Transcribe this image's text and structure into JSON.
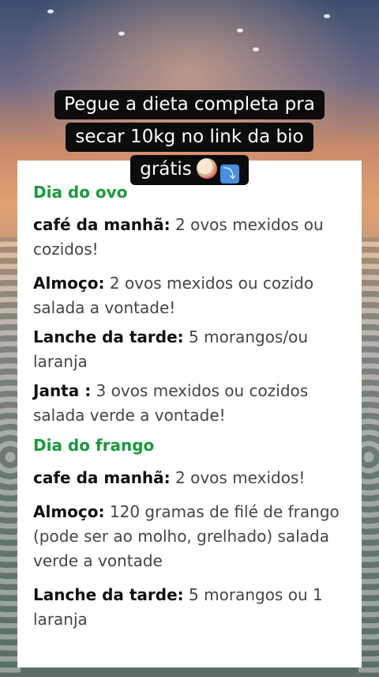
{
  "caption": {
    "line1": "Pegue a dieta completa pra",
    "line2": "secar 10kg no link da bio",
    "line3": "grátis"
  },
  "sections": [
    {
      "title": "Dia do ovo",
      "meals": [
        {
          "label": "café da manhã:",
          "text": " 2 ovos mexidos ou cozidos!"
        },
        {
          "label": "Almoço:",
          "text": " 2 ovos mexidos ou cozido salada a vontade!"
        },
        {
          "label": "Lanche da tarde:",
          "text": " 5 morangos/ou laranja"
        },
        {
          "label": "Janta :",
          "text": " 3 ovos mexidos ou cozidos salada verde a vontade!"
        }
      ]
    },
    {
      "title": "Dia do frango",
      "meals": [
        {
          "label": "cafe da manhã:",
          "text": " 2 ovos mexidos!"
        },
        {
          "label": "Almoço:",
          "text": " 120 gramas de filé de frango (pode ser ao molho, grelhado) salada verde a vontade"
        },
        {
          "label": "Lanche da tarde:",
          "text": " 5 morangos ou 1 laranja"
        }
      ]
    }
  ],
  "icons": [
    "salad-bowl-icon",
    "arrow-down-icon"
  ],
  "colors": {
    "section_title": "#1a9a3a",
    "caption_bg": "#0c0c0c"
  }
}
